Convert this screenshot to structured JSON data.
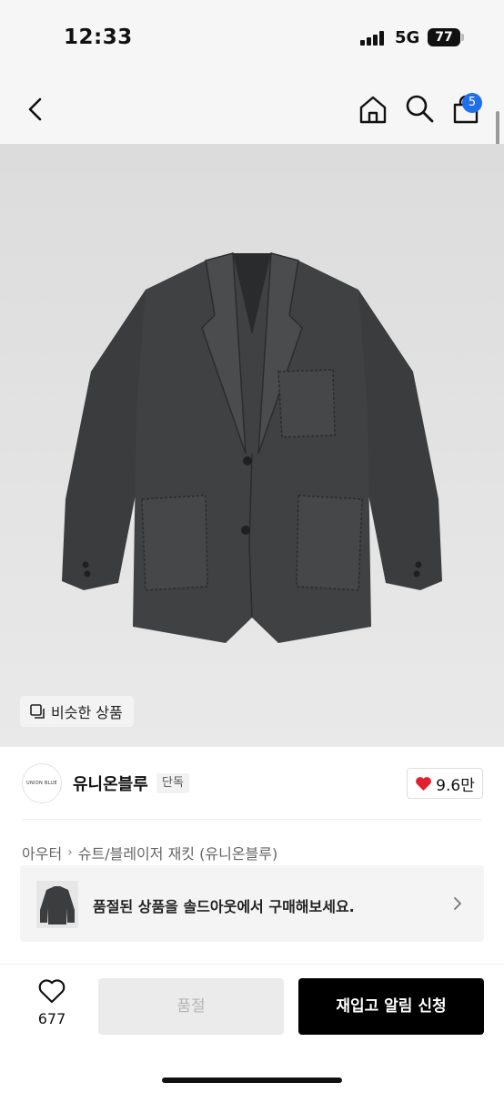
{
  "status_bar": {
    "time": "12:33",
    "network": "5G",
    "battery": "77"
  },
  "nav": {
    "cart_badge": "5",
    "icons": [
      "back-arrow-icon",
      "home-icon",
      "search-icon",
      "cart-icon"
    ]
  },
  "product": {
    "similar_button": "비슷한 상품",
    "brand": {
      "logo_text": "UNION BLUE",
      "name": "유니온블루",
      "tag": "단독",
      "likes": "9.6만"
    },
    "breadcrumb": [
      "아우터",
      "슈트/블레이저 재킷 (유니온블루)"
    ],
    "soldout_banner": "품절된 상품을 솔드아웃에서 구매해보세요."
  },
  "bottom_bar": {
    "wish_count": "677",
    "soldout_label": "품절",
    "restock_label": "재입고 알림 신청"
  },
  "colors": {
    "accent_badge": "#1f6feb",
    "heart": "#e5202e",
    "primary_button": "#000000"
  }
}
